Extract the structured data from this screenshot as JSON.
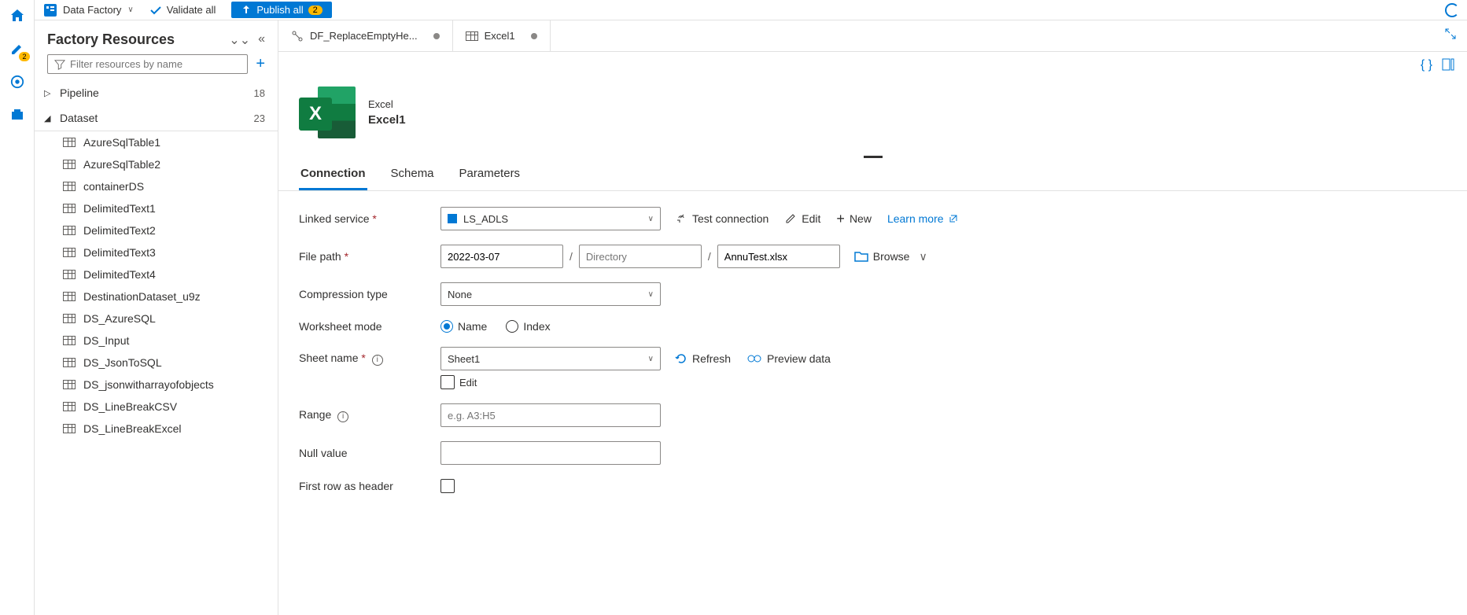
{
  "topbar": {
    "title": "Data Factory",
    "validate": "Validate all",
    "publish": "Publish all",
    "publish_count": "2"
  },
  "leftnav_badge": "2",
  "resources": {
    "title": "Factory Resources",
    "filter_ph": "Filter resources by name",
    "sections": [
      {
        "name": "Pipeline",
        "count": "18",
        "expanded": false
      },
      {
        "name": "Dataset",
        "count": "23",
        "expanded": true
      }
    ],
    "datasets": [
      "AzureSqlTable1",
      "AzureSqlTable2",
      "containerDS",
      "DelimitedText1",
      "DelimitedText2",
      "DelimitedText3",
      "DelimitedText4",
      "DestinationDataset_u9z",
      "DS_AzureSQL",
      "DS_Input",
      "DS_JsonToSQL",
      "DS_jsonwitharrayofobjects",
      "DS_LineBreakCSV",
      "DS_LineBreakExcel"
    ]
  },
  "tabs": [
    {
      "label": "DF_ReplaceEmptyHe...",
      "dirty": true,
      "kind": "dataflow"
    },
    {
      "label": "Excel1",
      "dirty": true,
      "kind": "dataset",
      "active": true
    }
  ],
  "dataset": {
    "type_label": "Excel",
    "name": "Excel1"
  },
  "detail_tabs": [
    "Connection",
    "Schema",
    "Parameters"
  ],
  "form": {
    "linked_service_lbl": "Linked service",
    "linked_service_val": "LS_ADLS",
    "test_conn": "Test connection",
    "edit": "Edit",
    "new": "New",
    "learn_more": "Learn more",
    "file_path_lbl": "File path",
    "container": "2022-03-07",
    "dir_ph": "Directory",
    "file": "AnnuTest.xlsx",
    "browse": "Browse",
    "compression_lbl": "Compression type",
    "compression_val": "None",
    "ws_mode_lbl": "Worksheet mode",
    "ws_name": "Name",
    "ws_index": "Index",
    "sheet_lbl": "Sheet name",
    "sheet_val": "Sheet1",
    "edit_chk": "Edit",
    "refresh": "Refresh",
    "preview": "Preview data",
    "range_lbl": "Range",
    "range_ph": "e.g. A3:H5",
    "null_lbl": "Null value",
    "firstrow_lbl": "First row as header"
  }
}
